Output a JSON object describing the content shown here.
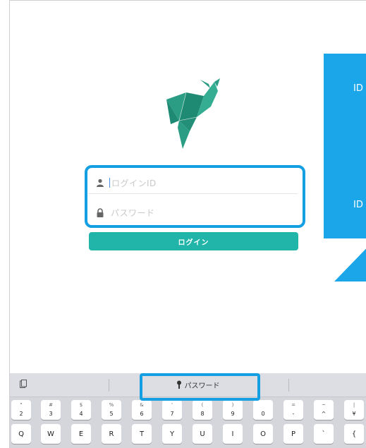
{
  "login": {
    "id_placeholder": "ログインID",
    "password_placeholder": "パスワード",
    "login_button": "ログイン"
  },
  "callout": {
    "line1": "ID",
    "line2": "ID"
  },
  "keyboard": {
    "password_autofill_label": "パスワード",
    "number_row": [
      {
        "top": "\"",
        "bot": "2"
      },
      {
        "top": "#",
        "bot": "3"
      },
      {
        "top": "$",
        "bot": "4"
      },
      {
        "top": "%",
        "bot": "5"
      },
      {
        "top": "&",
        "bot": "6"
      },
      {
        "top": "'",
        "bot": "7"
      },
      {
        "top": "(",
        "bot": "8"
      },
      {
        "top": ")",
        "bot": "9"
      },
      {
        "top": "",
        "bot": "0"
      },
      {
        "top": "=",
        "bot": "-"
      },
      {
        "top": "~",
        "bot": "^"
      },
      {
        "top": "|",
        "bot": "¥"
      }
    ],
    "letter_row": [
      "Q",
      "W",
      "E",
      "R",
      "T",
      "Y",
      "U",
      "I",
      "O",
      "P",
      "`",
      "{"
    ]
  },
  "colors": {
    "accent_blue": "#159fe3",
    "button_teal": "#21b5aa",
    "logo_teal": "#2a9d84"
  }
}
